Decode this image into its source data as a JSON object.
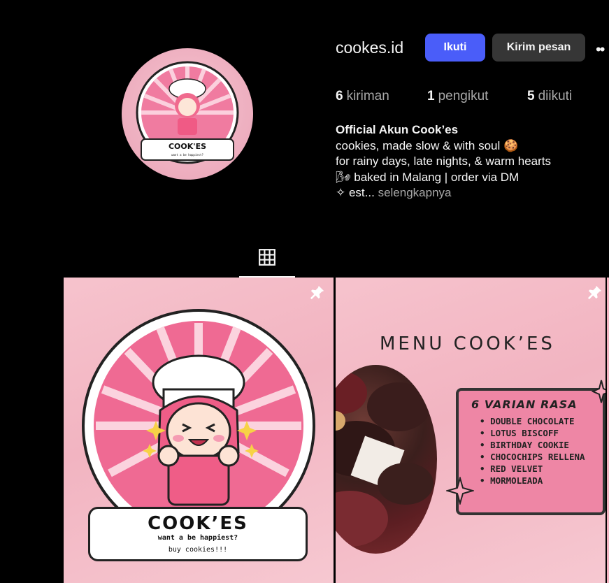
{
  "profile": {
    "username": "cookes.id",
    "follow_label": "Ikuti",
    "message_label": "Kirim pesan",
    "more_label": "••",
    "avatar_icon": "cookes-logo-avatar"
  },
  "stats": {
    "posts_count": "6",
    "posts_label": "kiriman",
    "followers_count": "1",
    "followers_label": "pengikut",
    "following_count": "5",
    "following_label": "diikuti"
  },
  "bio": {
    "name": "Official Akun Cook’es",
    "line1": "cookies, made slow & with soul 🍪",
    "line2": "for rainy days, late nights, & warm hearts",
    "line3": "🌬 baked in Malang | order via DM",
    "line4": "✧ est...",
    "more_link": "selengkapnya"
  },
  "tabs": {
    "grid_icon": "grid-icon"
  },
  "posts": [
    {
      "pinned": true,
      "logo_brand": "COOK’ES",
      "logo_tagline": "want a be happiest?",
      "logo_sub": "buy cookies!!!"
    },
    {
      "pinned": true,
      "title": "MENU COOK’ES",
      "card_heading": "6 VARIAN RASA",
      "items": [
        "DOUBLE CHOCOLATE",
        "LOTUS BISCOFF",
        "BIRTHDAY COOKIE",
        "CHOCOCHIPS RELLENA",
        "RED VELVET",
        "MORMOLEADA"
      ]
    }
  ],
  "colors": {
    "background": "#000000",
    "follow_button": "#4a5df9",
    "message_button": "#363636",
    "post_pink": "#f2b4c1",
    "accent_pink": "#ee5a86"
  }
}
